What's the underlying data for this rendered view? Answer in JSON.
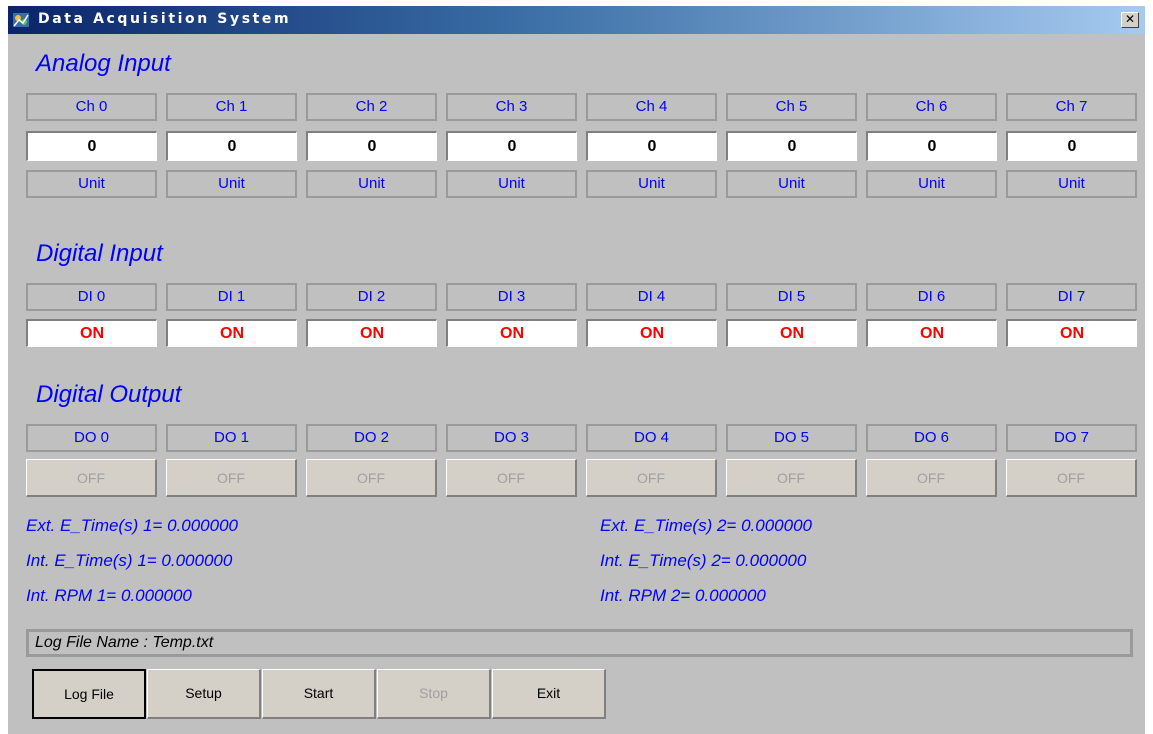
{
  "window": {
    "title": "Data Acquisition System",
    "close_glyph": "✕",
    "icon": "app-icon"
  },
  "analog_input": {
    "title": "Analog Input",
    "channels": [
      "Ch 0",
      "Ch 1",
      "Ch 2",
      "Ch 3",
      "Ch 4",
      "Ch 5",
      "Ch 6",
      "Ch 7"
    ],
    "values": [
      "0",
      "0",
      "0",
      "0",
      "0",
      "0",
      "0",
      "0"
    ],
    "units": [
      "Unit",
      "Unit",
      "Unit",
      "Unit",
      "Unit",
      "Unit",
      "Unit",
      "Unit"
    ]
  },
  "digital_input": {
    "title": "Digital Input",
    "channels": [
      "DI 0",
      "DI 1",
      "DI 2",
      "DI 3",
      "DI 4",
      "DI 5",
      "DI 6",
      "DI 7"
    ],
    "states": [
      "ON",
      "ON",
      "ON",
      "ON",
      "ON",
      "ON",
      "ON",
      "ON"
    ],
    "state_color": "#ff0000"
  },
  "digital_output": {
    "title": "Digital Output",
    "channels": [
      "DO 0",
      "DO 1",
      "DO 2",
      "DO 3",
      "DO 4",
      "DO 5",
      "DO 6",
      "DO 7"
    ],
    "buttons": [
      "OFF",
      "OFF",
      "OFF",
      "OFF",
      "OFF",
      "OFF",
      "OFF",
      "OFF"
    ]
  },
  "readouts": {
    "ext_etime_1": "Ext. E_Time(s) 1=  0.000000",
    "int_etime_1": "Int. E_Time(s) 1=  0.000000",
    "int_rpm_1": "Int. RPM 1=  0.000000",
    "ext_etime_2": "Ext. E_Time(s) 2=  0.000000",
    "int_etime_2": "Int. E_Time(s) 2=  0.000000",
    "int_rpm_2": "Int. RPM 2=  0.000000"
  },
  "log_file": {
    "label": "Log File Name : Temp.txt"
  },
  "buttons": {
    "log_file": "Log File",
    "setup": "Setup",
    "start": "Start",
    "stop": "Stop",
    "exit": "Exit"
  },
  "colors": {
    "accent": "#0000ff",
    "background": "#c0c0c0"
  }
}
